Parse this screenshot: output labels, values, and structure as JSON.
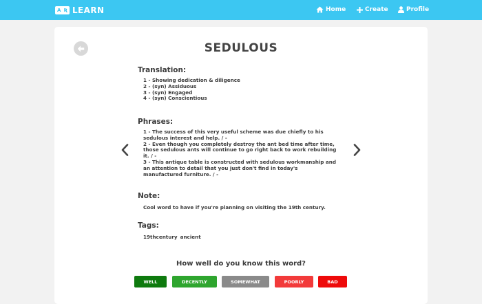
{
  "brand": {
    "logo_left": "A",
    "logo_right": "Ʀ",
    "name": "LEARN"
  },
  "nav": {
    "home": "Home",
    "create": "Create",
    "profile": "Profile"
  },
  "word": "SEDULOUS",
  "translation": {
    "title": "Translation:",
    "items": [
      "1 - Showing dedication & diligence",
      "2 - (syn) Assiduous",
      "3 - (syn) Engaged",
      "4 - (syn) Conscientious"
    ]
  },
  "phrases": {
    "title": "Phrases:",
    "items": [
      "1 - The success of this very useful scheme was due chiefly to his sedulous interest and help. / -",
      "2 - Even though you completely destroy the ant bed time after time, those sedulous ants will continue to go right back to work rebuilding it. / -",
      "3 - This antique table is constructed with sedulous workmanship and an attention to detail that you just don't find in today's manufactured furniture. / -"
    ]
  },
  "note": {
    "title": "Note:",
    "text": "Cool word to have if you're planning on visiting the 19th century."
  },
  "tags": {
    "title": "Tags:",
    "items": [
      "19thcentury",
      "ancient"
    ]
  },
  "rating": {
    "question": "How well do you know this word?",
    "buttons": [
      {
        "label": "WELL",
        "color": "#0e7a0e"
      },
      {
        "label": "DECENTLY",
        "color": "#2ea52e"
      },
      {
        "label": "SOMEWHAT",
        "color": "#8a8a8a"
      },
      {
        "label": "POORLY",
        "color": "#f23a3a"
      },
      {
        "label": "BAD",
        "color": "#ee0a0a"
      }
    ]
  },
  "colors": {
    "navbar": "#3cc7f2",
    "background": "#f2f2f2",
    "card": "#ffffff"
  }
}
